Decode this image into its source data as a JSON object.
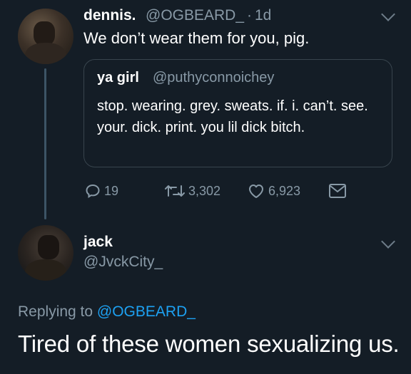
{
  "tweet": {
    "author_name": "dennis.",
    "author_handle": "@OGBEARD_",
    "separator": "·",
    "time": "1d",
    "text": "We don’t wear them for you, pig.",
    "quote": {
      "author_name": "ya girl",
      "author_handle": "@puthyconnoichey",
      "text": "stop. wearing. grey. sweats. if. i. can’t. see. your. dick. print. you lil dick bitch."
    },
    "actions": {
      "replies": "19",
      "retweets": "3,302",
      "likes": "6,923"
    }
  },
  "reply": {
    "author_name": "jack",
    "author_handle": "@JvckCity_",
    "replying_to_label": "Replying to",
    "replying_to_handle": "@OGBEARD_",
    "text": "Tired of these women sexualizing us."
  },
  "colors": {
    "background": "#141d26",
    "secondary_text": "#8899a6",
    "link": "#1da1f2",
    "border": "#38444d"
  },
  "icons": [
    "chevron-down-icon",
    "reply-icon",
    "retweet-icon",
    "like-icon",
    "message-icon"
  ]
}
